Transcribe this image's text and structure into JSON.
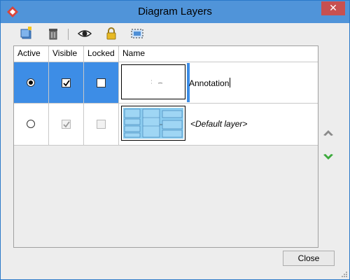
{
  "window": {
    "title": "Diagram Layers",
    "close_glyph": "✕"
  },
  "toolbar": {
    "buttons": [
      {
        "icon": "new-layer-icon"
      },
      {
        "icon": "delete-icon"
      },
      {
        "icon": "eye-icon"
      },
      {
        "icon": "lock-icon"
      },
      {
        "icon": "select-icon"
      }
    ]
  },
  "table": {
    "columns": [
      "Active",
      "Visible",
      "Locked",
      "Name"
    ],
    "rows": [
      {
        "active": true,
        "visible": true,
        "locked": false,
        "name": "Annotation",
        "editing": true,
        "selected": true
      },
      {
        "active": false,
        "visible": true,
        "locked": false,
        "name": "<Default layer>",
        "editing": false,
        "selected": false,
        "disabled_checks": true
      }
    ]
  },
  "side_buttons": {
    "up_icon": "move-up-icon",
    "down_icon": "move-down-icon"
  },
  "footer": {
    "close_label": "Close"
  },
  "colors": {
    "titlebar": "#5094d9",
    "selection": "#3d8de6",
    "close_x": "#c75050"
  }
}
